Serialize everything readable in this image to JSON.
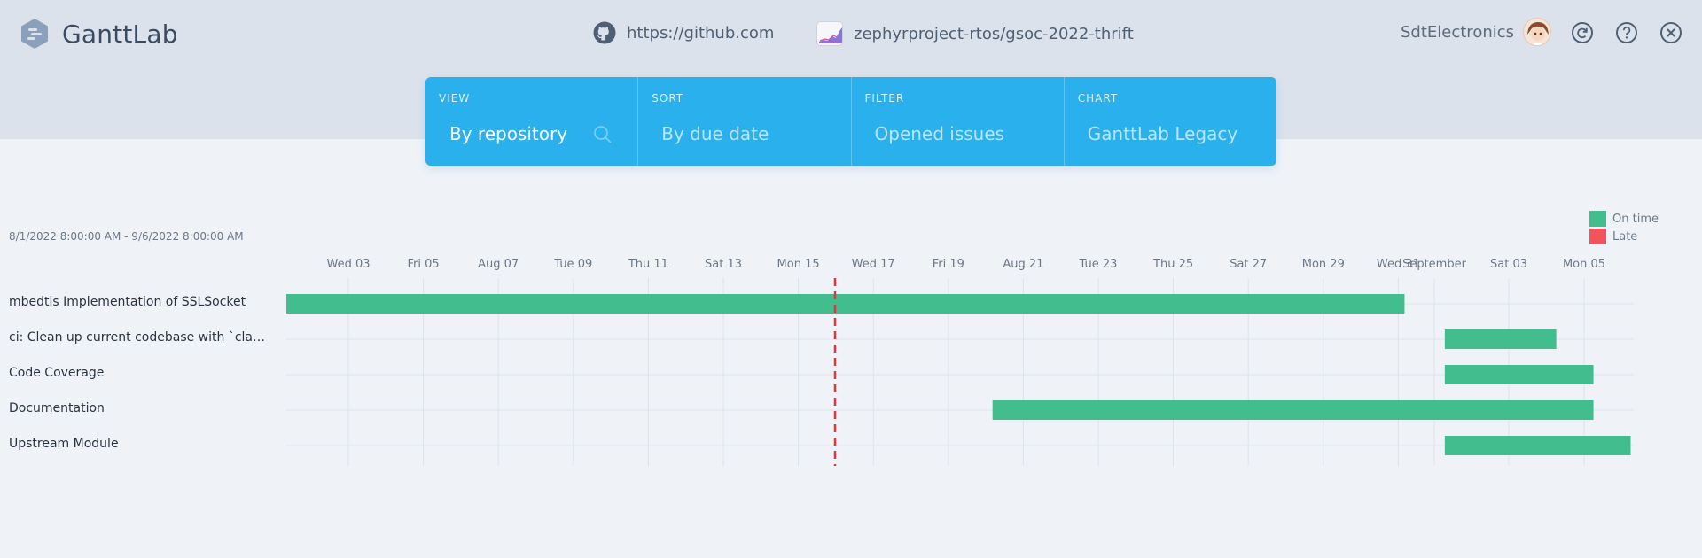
{
  "app": {
    "name": "GanttLab"
  },
  "header": {
    "source_url": "https://github.com",
    "project": "zephyrproject-rtos/gsoc-2022-thrift",
    "user": "SdtElectronics"
  },
  "toolbar": [
    {
      "label": "VIEW",
      "value": "By repository"
    },
    {
      "label": "SORT",
      "value": "By due date"
    },
    {
      "label": "FILTER",
      "value": "Opened issues"
    },
    {
      "label": "CHART",
      "value": "GanttLab Legacy"
    }
  ],
  "colors": {
    "on_time": "#41bd8e",
    "late": "#f0545c",
    "today_marker": "#e0363c",
    "accent": "#2ab0ec"
  },
  "chart_data": {
    "type": "gantt",
    "date_range": "8/1/2022 8:00:00 AM - 9/6/2022 8:00:00 AM",
    "legend": [
      "On time",
      "Late"
    ],
    "tick_labels": [
      "Wed 03",
      "Fri 05",
      "Aug 07",
      "Tue 09",
      "Thu 11",
      "Sat 13",
      "Mon 15",
      "Wed 17",
      "Fri 19",
      "Aug 21",
      "Tue 23",
      "Thu 25",
      "Sat 27",
      "Mon 29",
      "Wed 31",
      "September",
      "Sat 03",
      "Mon 05"
    ],
    "today": "2022-08-16",
    "tasks": [
      {
        "name": "mbedtls Implementation of SSLSocket",
        "start": "2022-08-01T08:00",
        "end": "2022-08-31T10:00",
        "status": "On time"
      },
      {
        "name": "ci: Clean up current codebase with `clang-…",
        "start": "2022-09-01T12:00",
        "end": "2022-09-04T12:00",
        "status": "On time"
      },
      {
        "name": "Code Coverage",
        "start": "2022-09-01T12:00",
        "end": "2022-09-05T12:00",
        "status": "On time"
      },
      {
        "name": "Documentation",
        "start": "2022-08-20T08:00",
        "end": "2022-09-05T12:00",
        "status": "On time"
      },
      {
        "name": "Upstream Module",
        "start": "2022-09-01T12:00",
        "end": "2022-09-06T12:00",
        "status": "On time"
      }
    ]
  }
}
